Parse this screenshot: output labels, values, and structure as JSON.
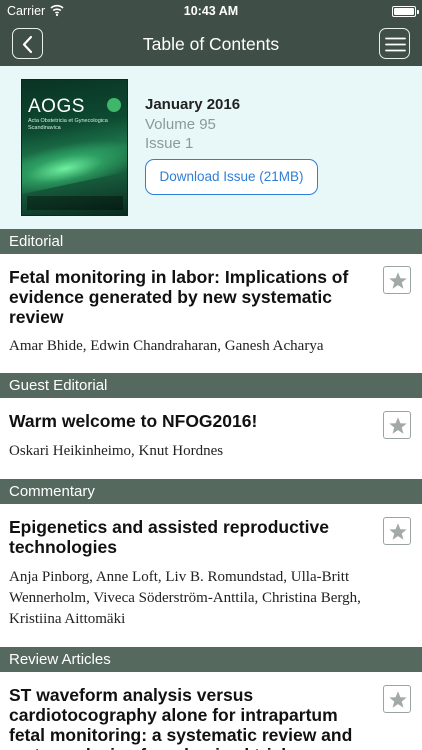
{
  "status_bar": {
    "carrier": "Carrier",
    "time": "10:43 AM",
    "battery_level": 1.0
  },
  "nav": {
    "title": "Table of Contents",
    "back_icon": "chevron-left-icon",
    "menu_icon": "hamburger-menu-icon"
  },
  "issue": {
    "cover_title": "AOGS",
    "cover_subtitle": "Acta Obstetricia et Gynecologica Scandinavica",
    "month": "January 2016",
    "volume": "Volume 95",
    "issue_number": "Issue 1",
    "download_label": "Download Issue (21MB)"
  },
  "sections": [
    {
      "heading": "Editorial",
      "articles": [
        {
          "title": "Fetal monitoring in labor: Implications of evidence generated by new systematic review",
          "authors": "Amar Bhide, Edwin Chandraharan, Ganesh Acharya"
        }
      ]
    },
    {
      "heading": "Guest Editorial",
      "articles": [
        {
          "title": "Warm welcome to NFOG2016!",
          "authors": "Oskari Heikinheimo, Knut Hordnes"
        }
      ]
    },
    {
      "heading": "Commentary",
      "articles": [
        {
          "title": "Epigenetics and assisted reproductive technologies",
          "authors": "Anja Pinborg, Anne Loft, Liv B. Romundstad, Ulla-Britt Wennerholm, Viveca Söderström-Anttila, Christina Bergh, Kristiina Aittomäki"
        }
      ]
    },
    {
      "heading": "Review Articles",
      "articles": [
        {
          "title": "ST waveform analysis versus cardiotocography alone for intrapartum fetal monitoring: a systematic review and meta-analysis of randomized trials",
          "authors": ""
        }
      ]
    }
  ],
  "colors": {
    "nav_bg": "#3f4f47",
    "section_bg": "#56695f",
    "issue_bg": "#e8f8f8",
    "accent": "#2f7fd6"
  }
}
